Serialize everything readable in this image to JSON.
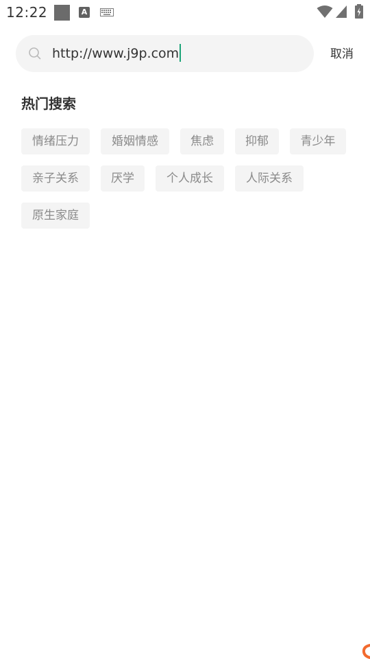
{
  "status_bar": {
    "time": "12:22",
    "icons": [
      "image-notification-icon",
      "a-notification-icon",
      "keyboard-icon",
      "wifi-icon",
      "signal-icon",
      "battery-icon"
    ],
    "a_icon_letter": "A"
  },
  "search": {
    "value": "http://www.j9p.com",
    "cancel_label": "取消",
    "caret_color": "#1aa377"
  },
  "hot_search": {
    "title": "热门搜索",
    "tags": [
      "情绪压力",
      "婚姻情感",
      "焦虑",
      "抑郁",
      "青少年",
      "亲子关系",
      "厌学",
      "个人成长",
      "人际关系",
      "原生家庭"
    ]
  },
  "colors": {
    "background": "#ffffff",
    "chip_background": "#f4f4f4",
    "chip_text": "#8a8a8a",
    "primary_text": "#333333",
    "accent": "#1aa377",
    "corner_mark": "#f26a2e"
  }
}
